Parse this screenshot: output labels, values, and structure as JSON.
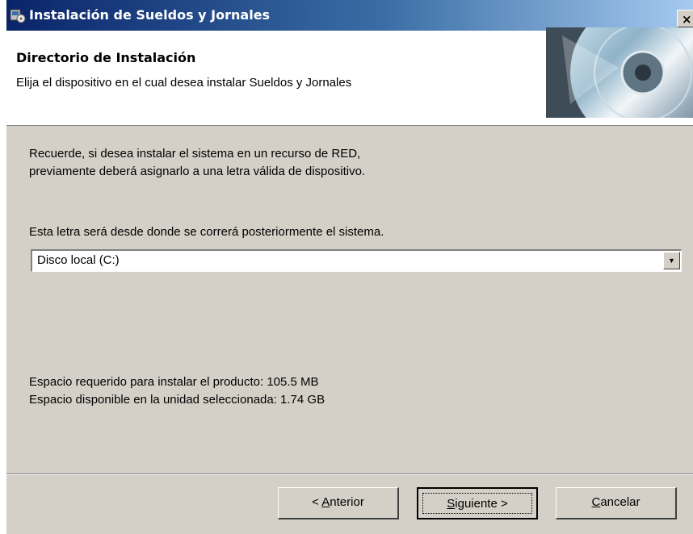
{
  "window": {
    "title": "Instalación de Sueldos y Jornales",
    "close_glyph": "×",
    "app_icon": "installer-icon"
  },
  "header": {
    "title": "Directorio de Instalación",
    "subtitle": "Elija el dispositivo en el cual desea instalar Sueldos y Jornales",
    "graphic": "cd-disc-image"
  },
  "body": {
    "notice_line1": "Recuerde, si desea instalar el sistema en un recurso de RED,",
    "notice_line2": "previamente deberá asignarlo a una letra válida de dispositivo.",
    "drive_label": "Esta letra será desde donde se correrá posteriormente el sistema.",
    "drive_selected": "Disco local (C:)",
    "space_required": "Espacio requerido para instalar el producto: 105.5 MB",
    "space_available": "Espacio disponible en la unidad seleccionada: 1.74 GB"
  },
  "buttons": {
    "back_prefix": "< ",
    "back_mnemonic": "A",
    "back_rest": "nterior",
    "next_mnemonic": "S",
    "next_rest": "iguiente >",
    "cancel_mnemonic": "C",
    "cancel_rest": "ancelar"
  }
}
